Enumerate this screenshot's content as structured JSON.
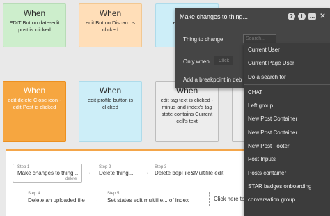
{
  "cards": [
    {
      "when": "When",
      "desc": "EDIT Button date-edit post is clicked"
    },
    {
      "when": "When",
      "desc": "edit Button Discard is clicked"
    },
    {
      "when": "When",
      "desc": "edit Discard"
    },
    {
      "when": "When",
      "desc": "edit delete Close icon - edit Post is clicked"
    },
    {
      "when": "When",
      "desc": "edit profile button is clicked"
    },
    {
      "when": "When",
      "desc": "edit tag text is clicked - minus and index's tag state contains Current cell's text"
    },
    {
      "when": "",
      "desc": ""
    }
  ],
  "steps": [
    {
      "label": "Step 1",
      "text": "Make changes to thing...",
      "delete": "delete"
    },
    {
      "label": "Step 2",
      "text": "Delete thing..."
    },
    {
      "label": "Step 3",
      "text": "Delete bepFile&Multifile edit"
    },
    {
      "label": "Step 4",
      "text": "Delete an uploaded file"
    },
    {
      "label": "Step 5",
      "text": "Set states edit multifile... of index"
    }
  ],
  "click_here": "Click here to",
  "panel": {
    "title": "Make changes to thing...",
    "icons": [
      "help-icon",
      "info-icon",
      "comment-icon",
      "close-icon"
    ],
    "thing_label": "Thing to change",
    "search_placeholder": "Search...",
    "only_when_label": "Only when",
    "only_when_value": "Click",
    "breakpoint_label": "Add a breakpoint in deb"
  },
  "dropdown": {
    "group1": [
      "Current User",
      "Current Page User",
      "Do a search for"
    ],
    "group2": [
      "CHAT",
      "Left group",
      "New Post Container",
      "New Post Container",
      "New Post Footer",
      "Post Inputs",
      "Posts container",
      "STAR badges onboarding",
      "conversation group"
    ]
  }
}
